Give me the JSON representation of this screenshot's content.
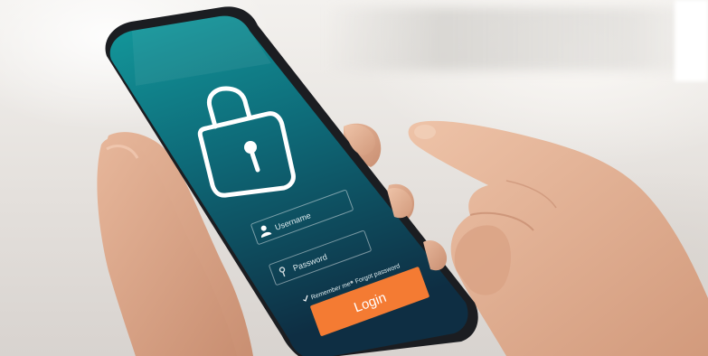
{
  "login_screen": {
    "username_placeholder": "Username",
    "password_placeholder": "Password",
    "remember_me_label": "Remember me",
    "forgot_password_label": "Forgot password",
    "login_button_label": "Login",
    "icons": [
      "padlock-icon",
      "user-icon",
      "key-icon",
      "check-icon"
    ]
  },
  "colors": {
    "screen_top": "#0f8e93",
    "screen_bottom": "#0f3347",
    "button_orange": "#f47b33",
    "skin": "#d9a88c"
  }
}
